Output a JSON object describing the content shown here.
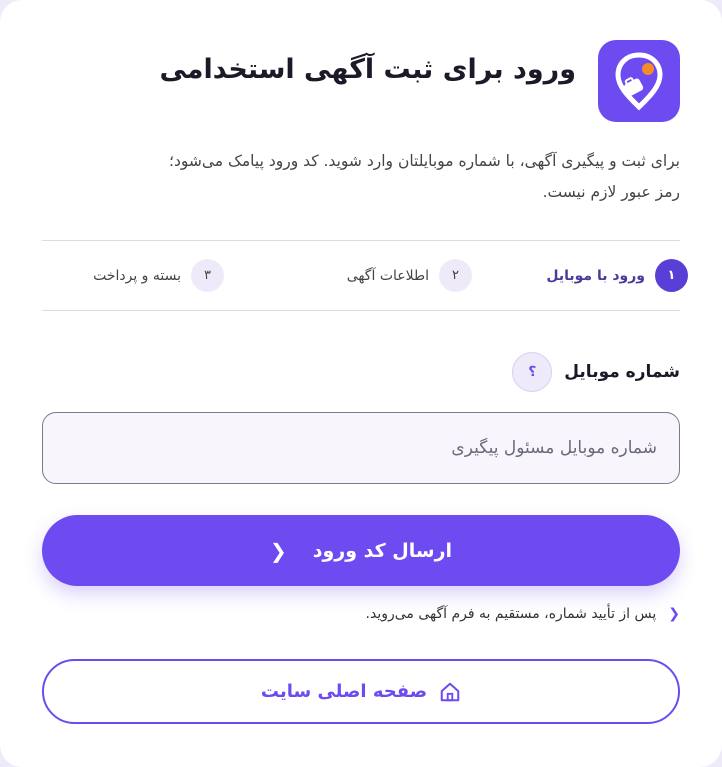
{
  "header": {
    "title": "ورود برای ثبت آگهی استخدامی",
    "logo_icon": "briefcase-pin-icon"
  },
  "description": "برای ثبت و پیگیری آگهی، با شماره موبایلتان وارد شوید. کد ورود پیامک می‌شود؛\nرمز عبور لازم نیست.",
  "steps": [
    {
      "num": "۱",
      "label": "ورود با موبایل",
      "active": true
    },
    {
      "num": "۲",
      "label": "اطلاعات آگهی",
      "active": false
    },
    {
      "num": "۳",
      "label": "بسته و پرداخت",
      "active": false
    }
  ],
  "mobile_field": {
    "label": "شماره موبایل",
    "help_symbol": "؟",
    "placeholder": "شماره موبایل مسئول پیگیری",
    "value": ""
  },
  "submit": {
    "label": "ارسال کد ورود",
    "icon": "chevron-left-icon"
  },
  "note": {
    "text": "پس از تأیید شماره، مستقیم به فرم آگهی می‌روید.",
    "icon": "chevron-left-icon"
  },
  "home_button": {
    "label": "صفحه اصلی سایت",
    "icon": "home-icon"
  },
  "colors": {
    "accent": "#6d4bf0",
    "accent_dark": "#5a3fd6",
    "background": "#efeaf9",
    "logo_dot": "#f28c28"
  }
}
